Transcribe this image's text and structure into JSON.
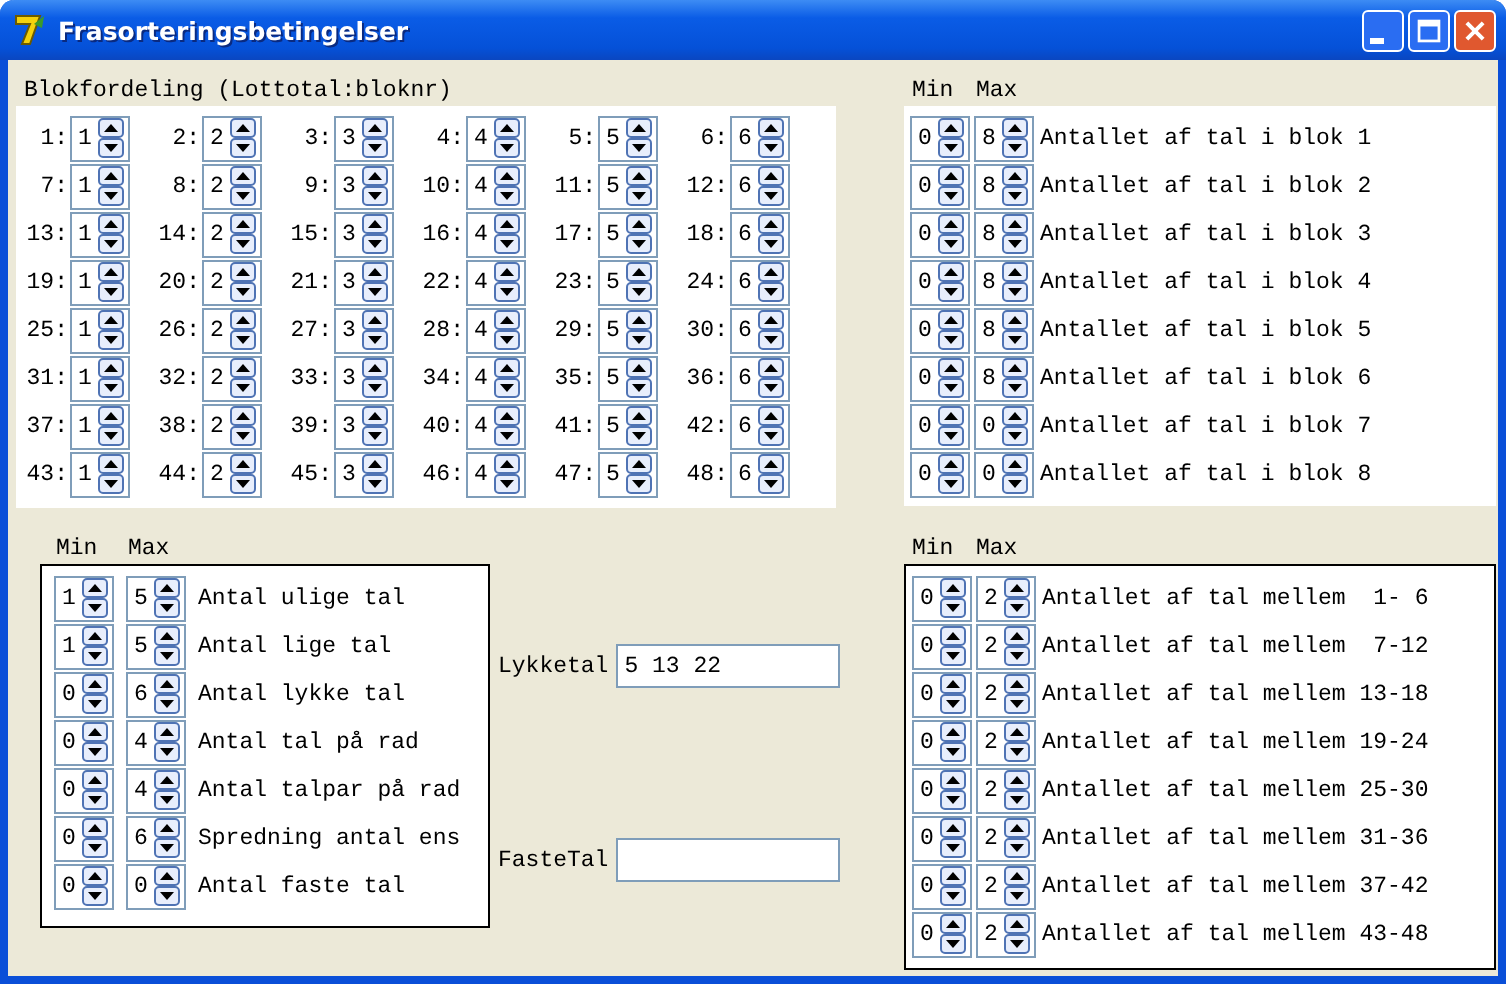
{
  "window": {
    "title": "Frasorteringsbetingelser"
  },
  "block_distribution": {
    "heading": "Blokfordeling (Lottotal:bloknr)",
    "cells": [
      {
        "number": "1:",
        "value": "1"
      },
      {
        "number": "2:",
        "value": "2"
      },
      {
        "number": "3:",
        "value": "3"
      },
      {
        "number": "4:",
        "value": "4"
      },
      {
        "number": "5:",
        "value": "5"
      },
      {
        "number": "6:",
        "value": "6"
      },
      {
        "number": "7:",
        "value": "1"
      },
      {
        "number": "8:",
        "value": "2"
      },
      {
        "number": "9:",
        "value": "3"
      },
      {
        "number": "10:",
        "value": "4"
      },
      {
        "number": "11:",
        "value": "5"
      },
      {
        "number": "12:",
        "value": "6"
      },
      {
        "number": "13:",
        "value": "1"
      },
      {
        "number": "14:",
        "value": "2"
      },
      {
        "number": "15:",
        "value": "3"
      },
      {
        "number": "16:",
        "value": "4"
      },
      {
        "number": "17:",
        "value": "5"
      },
      {
        "number": "18:",
        "value": "6"
      },
      {
        "number": "19:",
        "value": "1"
      },
      {
        "number": "20:",
        "value": "2"
      },
      {
        "number": "21:",
        "value": "3"
      },
      {
        "number": "22:",
        "value": "4"
      },
      {
        "number": "23:",
        "value": "5"
      },
      {
        "number": "24:",
        "value": "6"
      },
      {
        "number": "25:",
        "value": "1"
      },
      {
        "number": "26:",
        "value": "2"
      },
      {
        "number": "27:",
        "value": "3"
      },
      {
        "number": "28:",
        "value": "4"
      },
      {
        "number": "29:",
        "value": "5"
      },
      {
        "number": "30:",
        "value": "6"
      },
      {
        "number": "31:",
        "value": "1"
      },
      {
        "number": "32:",
        "value": "2"
      },
      {
        "number": "33:",
        "value": "3"
      },
      {
        "number": "34:",
        "value": "4"
      },
      {
        "number": "35:",
        "value": "5"
      },
      {
        "number": "36:",
        "value": "6"
      },
      {
        "number": "37:",
        "value": "1"
      },
      {
        "number": "38:",
        "value": "2"
      },
      {
        "number": "39:",
        "value": "3"
      },
      {
        "number": "40:",
        "value": "4"
      },
      {
        "number": "41:",
        "value": "5"
      },
      {
        "number": "42:",
        "value": "6"
      },
      {
        "number": "43:",
        "value": "1"
      },
      {
        "number": "44:",
        "value": "2"
      },
      {
        "number": "45:",
        "value": "3"
      },
      {
        "number": "46:",
        "value": "4"
      },
      {
        "number": "47:",
        "value": "5"
      },
      {
        "number": "48:",
        "value": "6"
      }
    ]
  },
  "block_limits": {
    "min_label": "Min",
    "max_label": "Max",
    "rows": [
      {
        "min": "0",
        "max": "8",
        "label": "Antallet af tal i blok 1"
      },
      {
        "min": "0",
        "max": "8",
        "label": "Antallet af tal i blok 2"
      },
      {
        "min": "0",
        "max": "8",
        "label": "Antallet af tal i blok 3"
      },
      {
        "min": "0",
        "max": "8",
        "label": "Antallet af tal i blok 4"
      },
      {
        "min": "0",
        "max": "8",
        "label": "Antallet af tal i blok 5"
      },
      {
        "min": "0",
        "max": "8",
        "label": "Antallet af tal i blok 6"
      },
      {
        "min": "0",
        "max": "0",
        "label": "Antallet af tal i blok 7"
      },
      {
        "min": "0",
        "max": "0",
        "label": "Antallet af tal i blok 8"
      }
    ]
  },
  "number_limits": {
    "min_label": "Min",
    "max_label": "Max",
    "rows": [
      {
        "min": "1",
        "max": "5",
        "label": "Antal ulige tal"
      },
      {
        "min": "1",
        "max": "5",
        "label": "Antal lige tal"
      },
      {
        "min": "0",
        "max": "6",
        "label": "Antal lykke tal"
      },
      {
        "min": "0",
        "max": "4",
        "label": "Antal tal på rad"
      },
      {
        "min": "0",
        "max": "4",
        "label": "Antal talpar på rad"
      },
      {
        "min": "0",
        "max": "6",
        "label": "Spredning antal ens"
      },
      {
        "min": "0",
        "max": "0",
        "label": "Antal faste tal"
      }
    ]
  },
  "fields": [
    {
      "label": "Lykketal",
      "value": "5 13 22"
    },
    {
      "label": "FasteTal"
    }
  ],
  "range_limits": {
    "min_label": "Min",
    "max_label": "Max",
    "rows": [
      {
        "min": "0",
        "max": "2",
        "label": "Antallet af tal mellem  1- 6"
      },
      {
        "min": "0",
        "max": "2",
        "label": "Antallet af tal mellem  7-12"
      },
      {
        "min": "0",
        "max": "2",
        "label": "Antallet af tal mellem 13-18"
      },
      {
        "min": "0",
        "max": "2",
        "label": "Antallet af tal mellem 19-24"
      },
      {
        "min": "0",
        "max": "2",
        "label": "Antallet af tal mellem 25-30"
      },
      {
        "min": "0",
        "max": "2",
        "label": "Antallet af tal mellem 31-36"
      },
      {
        "min": "0",
        "max": "2",
        "label": "Antallet af tal mellem 37-42"
      },
      {
        "min": "0",
        "max": "2",
        "label": "Antallet af tal mellem 43-48"
      }
    ]
  }
}
